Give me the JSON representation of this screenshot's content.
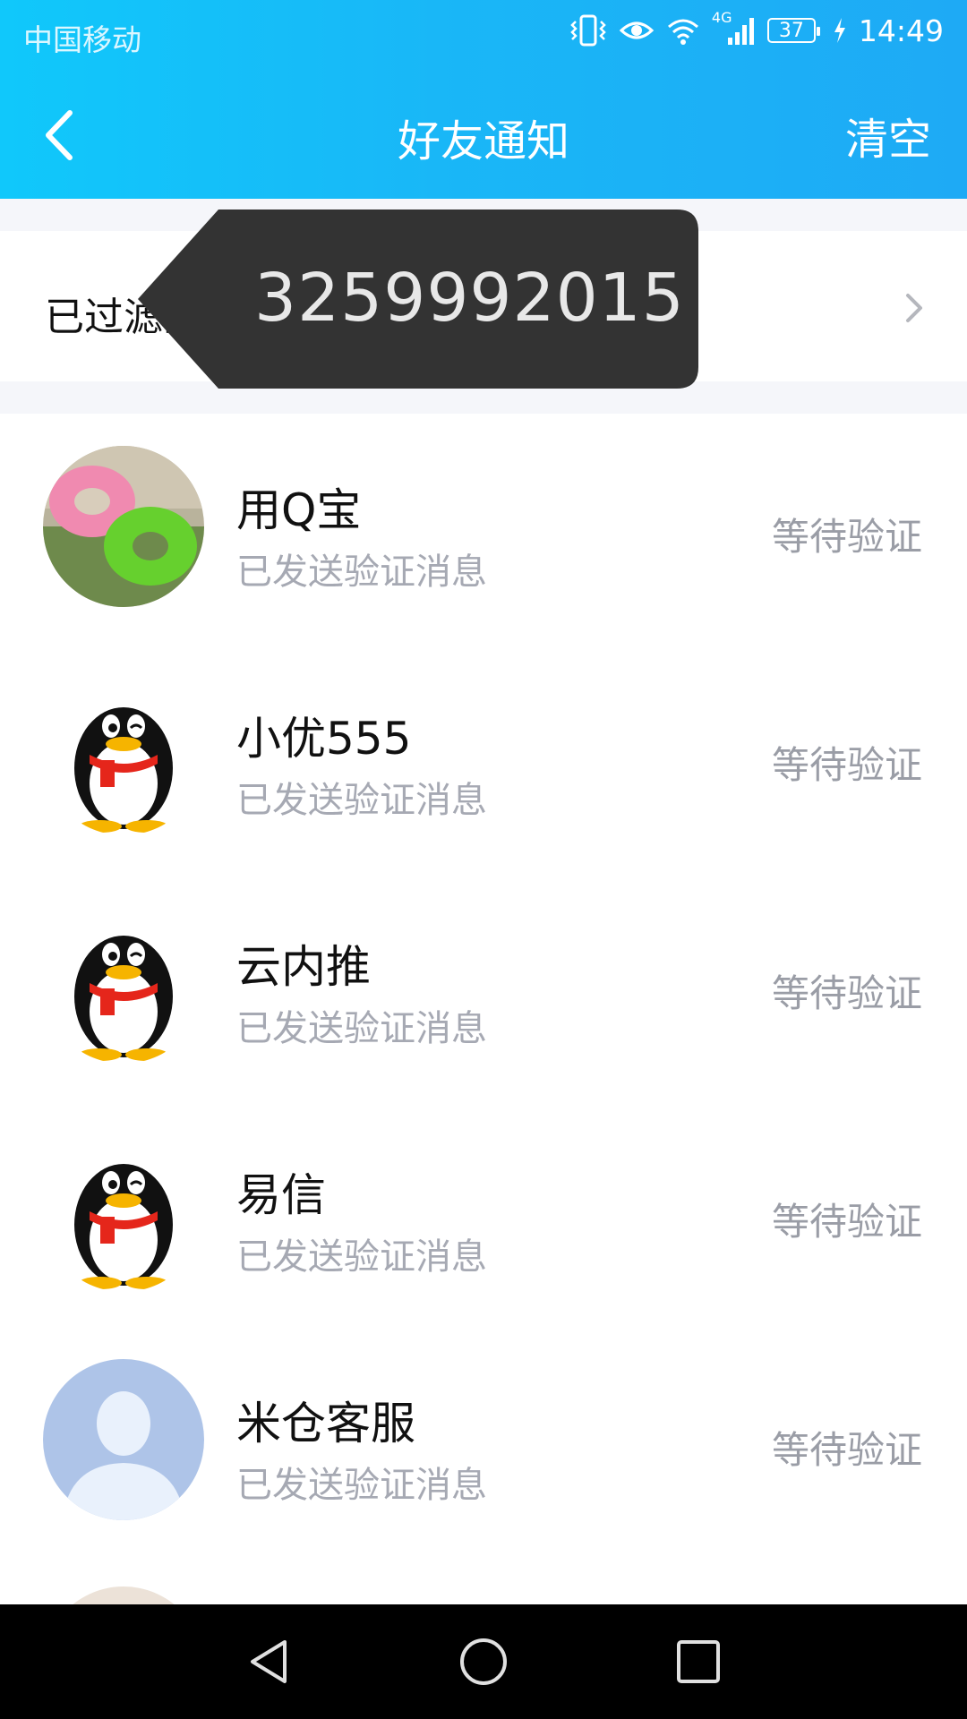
{
  "status_bar": {
    "carrier": "中国移动",
    "signal_type": "4G",
    "battery": "37",
    "time": "14:49"
  },
  "title_bar": {
    "title": "好友通知",
    "clear_label": "清空"
  },
  "filtered": {
    "label": "已过滤的通知"
  },
  "tooltip": {
    "text": "3259992015"
  },
  "contacts": [
    {
      "name": "用Q宝",
      "subtitle": "已发送验证消息",
      "status": "等待验证",
      "avatar": "photo-avatar"
    },
    {
      "name": "小优555",
      "subtitle": "已发送验证消息",
      "status": "等待验证",
      "avatar": "penguin-avatar"
    },
    {
      "name": "云内推",
      "subtitle": "已发送验证消息",
      "status": "等待验证",
      "avatar": "penguin-avatar"
    },
    {
      "name": "易信",
      "subtitle": "已发送验证消息",
      "status": "等待验证",
      "avatar": "penguin-avatar"
    },
    {
      "name": "米仓客服",
      "subtitle": "已发送验证消息",
      "status": "等待验证",
      "avatar": "default-person-avatar"
    }
  ],
  "colors": {
    "header_start": "#10c8fb",
    "header_end": "#1eaaf5",
    "tooltip_bg": "#333333",
    "secondary_text": "#a6a9b3"
  }
}
